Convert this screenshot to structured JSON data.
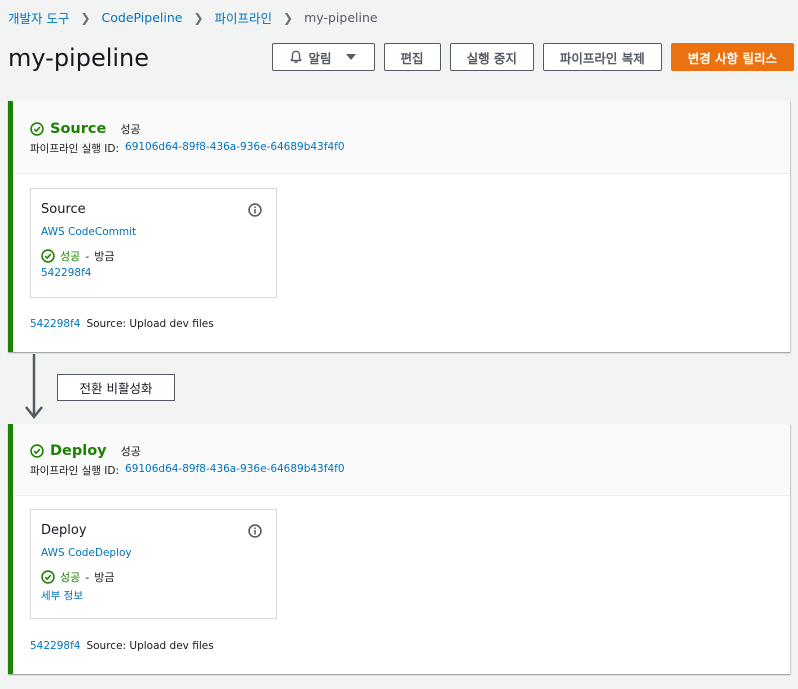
{
  "breadcrumb": [
    {
      "label": "개발자 도구"
    },
    {
      "label": "CodePipeline"
    },
    {
      "label": "파이프라인"
    },
    {
      "label": "my-pipeline"
    }
  ],
  "page": {
    "title": "my-pipeline"
  },
  "actions": {
    "notify": "알림",
    "edit": "편집",
    "stop": "실행 중지",
    "clone": "파이프라인 복제",
    "release": "변경 사항 릴리스"
  },
  "transition": {
    "label": "전환 비활성화"
  },
  "stages": [
    {
      "name": "Source",
      "status": "성공",
      "exec_label": "파이프라인 실행 ID:",
      "exec_id": "69106d64-89f8-436a-936e-64689b43f4f0",
      "action": {
        "name": "Source",
        "provider": "AWS CodeCommit",
        "status": "성공",
        "sep": "-",
        "time": "방금",
        "link": "542298f4"
      },
      "commit": {
        "id": "542298f4",
        "message": "Source: Upload dev files"
      }
    },
    {
      "name": "Deploy",
      "status": "성공",
      "exec_label": "파이프라인 실행 ID:",
      "exec_id": "69106d64-89f8-436a-936e-64689b43f4f0",
      "action": {
        "name": "Deploy",
        "provider": "AWS CodeDeploy",
        "status": "성공",
        "sep": "-",
        "time": "방금",
        "link": "세부 정보"
      },
      "commit": {
        "id": "542298f4",
        "message": "Source: Upload dev files"
      }
    }
  ],
  "colors": {
    "success": "#1d8102",
    "link": "#0073bb",
    "primary": "#ec7211"
  }
}
